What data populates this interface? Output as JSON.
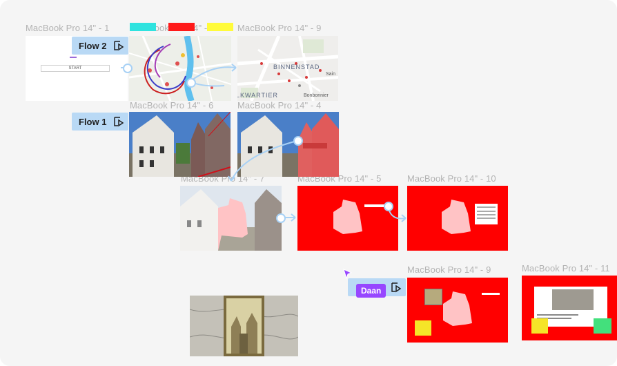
{
  "frames": {
    "f1": "MacBook Pro 14\" - 1",
    "f2": "MacBook Pro 14\" - 2",
    "f9a": "MacBook Pro 14\" - 9",
    "f6": "MacBook Pro 14\" - 6",
    "f4": "MacBook Pro 14\" - 4",
    "f7": "MacBook Pro 14\" - 7",
    "f5": "MacBook Pro 14\" - 5",
    "f10": "MacBook Pro 14\" - 10",
    "f9b": "MacBook Pro 14\" - 9",
    "f11": "MacBook Pro 14\" - 11"
  },
  "flows": {
    "flow2": "Flow 2",
    "flow1": "Flow 1"
  },
  "frame1": {
    "button": "START"
  },
  "map_labels": {
    "binnenstad": "BINNENSTAD",
    "kwartier": "LKWARTIER",
    "sain": "Sain",
    "bonbonnier": "Bonbonnier"
  },
  "cursor": {
    "user": "Daan",
    "color": "#9747ff"
  },
  "colors": {
    "accent": "#a8d1f5",
    "red_frame": "#ff0000",
    "canvas": "#f5f5f5"
  }
}
